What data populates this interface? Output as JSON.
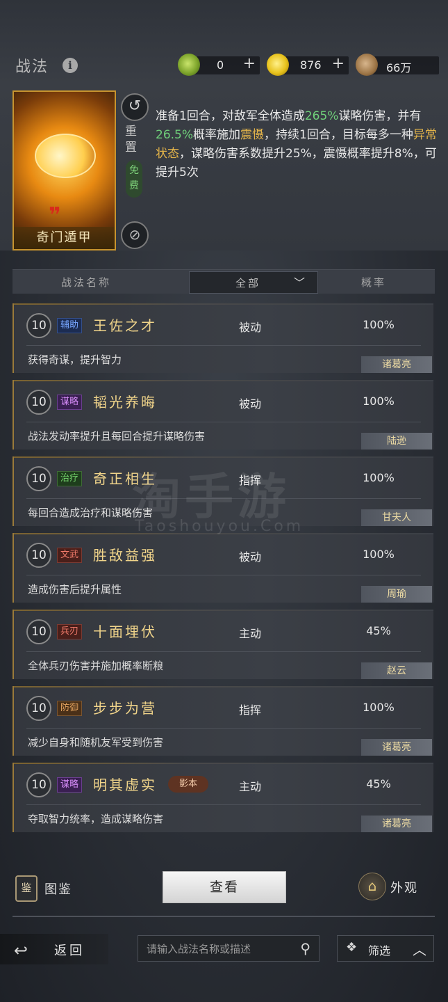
{
  "header": {
    "title": "战法",
    "info_icon": "i",
    "resources": [
      {
        "icon": "jade-coin-icon",
        "value": "0",
        "plus": "+"
      },
      {
        "icon": "gold-coin-icon",
        "value": "876",
        "plus": "+"
      },
      {
        "icon": "copper-coin-icon",
        "value": "66万"
      }
    ]
  },
  "selected_skill": {
    "name": "奇门遁甲",
    "reset_label": "重置",
    "free_label": "免费",
    "description": {
      "p1": "准备1回合，对敌军全体造成",
      "v1": "265%",
      "p2": "谋略伤害，并有",
      "v2": "26.5%",
      "p3": "概率施加",
      "s1": "震慑",
      "p4": "，持续1回合，目标每多一种",
      "s2": "异常状态",
      "p5": "，谋略伤害系数提升25%，震慑概率提升8%，可提升5次"
    }
  },
  "filter_bar": {
    "col_name": "战法名称",
    "dropdown_value": "全部",
    "col_rate": "概率"
  },
  "skills": [
    {
      "level": "10",
      "tag": "辅助",
      "tag_color": "blue",
      "name": "王佐之才",
      "type": "被动",
      "rate": "100%",
      "desc": "获得奇谋，提升智力",
      "general": "诸葛亮"
    },
    {
      "level": "10",
      "tag": "谋略",
      "tag_color": "purple",
      "name": "韬光养晦",
      "type": "被动",
      "rate": "100%",
      "desc": "战法发动率提升且每回合提升谋略伤害",
      "general": "陆逊"
    },
    {
      "level": "10",
      "tag": "治疗",
      "tag_color": "green",
      "name": "奇正相生",
      "type": "指挥",
      "rate": "100%",
      "desc": "每回合造成治疗和谋略伤害",
      "general": "甘夫人"
    },
    {
      "level": "10",
      "tag": "文武",
      "tag_color": "red",
      "name": "胜敌益强",
      "type": "被动",
      "rate": "100%",
      "desc": "造成伤害后提升属性",
      "general": "周瑜"
    },
    {
      "level": "10",
      "tag": "兵刃",
      "tag_color": "red",
      "name": "十面埋伏",
      "type": "主动",
      "rate": "45%",
      "desc": "全体兵刃伤害并施加概率断粮",
      "general": "赵云"
    },
    {
      "level": "10",
      "tag": "防御",
      "tag_color": "brown",
      "name": "步步为营",
      "type": "指挥",
      "rate": "100%",
      "desc": "减少自身和随机友军受到伤害",
      "general": "诸葛亮"
    },
    {
      "level": "10",
      "tag": "谋略",
      "tag_color": "purple",
      "name": "明其虚实",
      "shadow": "影本",
      "type": "主动",
      "rate": "45%",
      "desc": "夺取智力统率，造成谋略伤害",
      "general": "诸葛亮"
    }
  ],
  "actions": {
    "atlas_icon": "鉴",
    "atlas_label": "图鉴",
    "view_label": "查看",
    "appearance_label": "外观"
  },
  "footer": {
    "back_label": "返回",
    "search_placeholder": "请输入战法名称或描述",
    "filter_label": "筛选"
  },
  "watermark": {
    "main": "淘手游",
    "sub": "Taoshouyou.Com"
  }
}
